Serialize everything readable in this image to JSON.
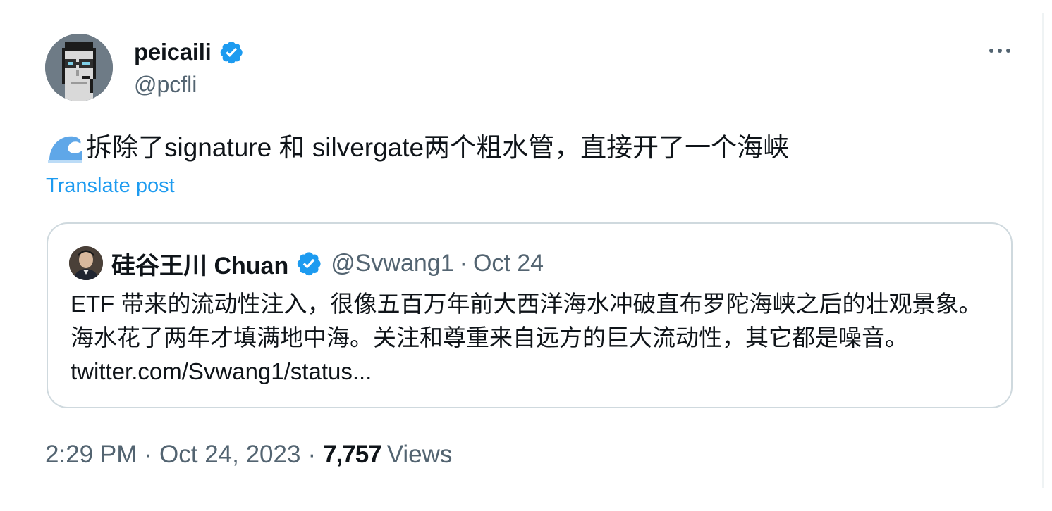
{
  "author": {
    "display_name": "peicaili",
    "handle": "@pcfli",
    "avatar_icon": "pixel-art-avatar",
    "verified_icon": "verified-badge-icon"
  },
  "tweet": {
    "emoji_icon": "water-wave-icon",
    "text": "拆除了signature 和 silvergate两个粗水管，直接开了一个海峡",
    "translate_label": "Translate post"
  },
  "quoted": {
    "display_name": "硅谷王川 Chuan",
    "handle": "@Svwang1",
    "separator": "·",
    "date": "Oct 24",
    "text": "ETF 带来的流动性注入，很像五百万年前大西洋海水冲破直布罗陀海峡之后的壮观景象。海水花了两年才填满地中海。关注和尊重来自远方的巨大流动性，其它都是噪音。",
    "link": "twitter.com/Svwang1/status..."
  },
  "meta": {
    "time": "2:29 PM",
    "sep1": "·",
    "date": "Oct 24, 2023",
    "sep2": "·",
    "views_count": "7,757",
    "views_label": "Views"
  },
  "colors": {
    "accent": "#1d9bf0",
    "text": "#0f1419",
    "secondary": "#536471",
    "border": "#cfd9de"
  }
}
